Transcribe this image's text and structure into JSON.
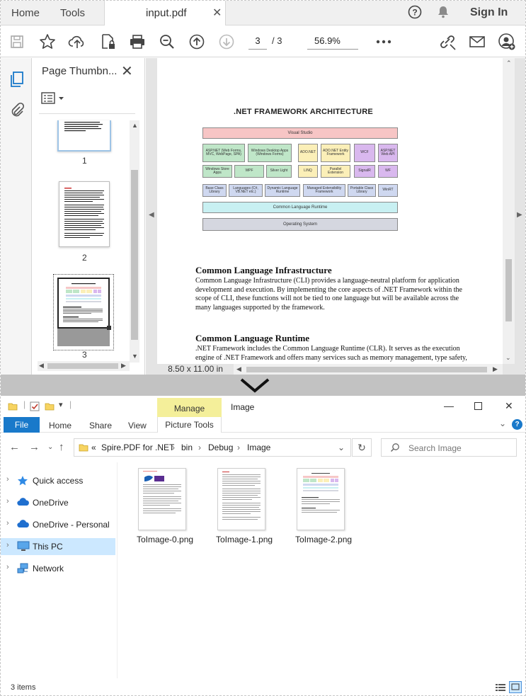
{
  "acrobat": {
    "tabs": {
      "home": "Home",
      "tools": "Tools",
      "document": "input.pdf"
    },
    "sign_in": "Sign In",
    "toolbar": {
      "current_page": "3",
      "total_pages": "/ 3",
      "zoom": "56.9%"
    },
    "thumbnails": {
      "title": "Page Thumbn...",
      "pages": [
        "1",
        "2",
        "3"
      ]
    },
    "page_size": "8.50 x 11.00 in",
    "document": {
      "diagram_title": ".NET FRAMEWORK ARCHITECTURE",
      "boxes": {
        "visual_studio": "Visual Studio",
        "aspnet": "ASP.NET (Web Forms, MVC, WebPage, SPA)",
        "windows_desktop": "Windows Desktop Apps (Windows Forms)",
        "adonet": "ADO.NET",
        "entity": "ADO.NET Entity Framework",
        "wcf": "WCF",
        "webapi": "ASP.NET Web API",
        "store_apps": "Windows Store Apps",
        "wpf": "WPF",
        "silverlight": "Silver Light",
        "linq": "LINQ",
        "parallel": "Parallel Extension",
        "signalr": "SignalR",
        "wf": "WF",
        "bcl": "Base Class Library",
        "languages": "Languages (C#, VB.NET etc.)",
        "dlr": "Dynamic Language Runtime",
        "mef": "Managed Extensibility Framework",
        "portable": "Portable Class Library",
        "winrt": "WinRT",
        "clr": "Common Language Runtime",
        "os": "Operating System"
      },
      "section1_heading": "Common Language Infrastructure",
      "section1_body": "Common Language Infrastructure (CLI) provides a language-neutral platform for application development and execution. By implementing the core aspects of .NET Framework within the scope of CLI, these functions will not be tied to one language but will be available across the many languages supported by the framework.",
      "section2_heading": "Common Language Runtime",
      "section2_body": ".NET Framework includes the Common Language Runtime (CLR). It serves as the execution engine of .NET Framework and offers many services such as memory management, type safety,"
    }
  },
  "explorer": {
    "manage_tab": "Manage",
    "window_title": "Image",
    "ribbon": {
      "file": "File",
      "home": "Home",
      "share": "Share",
      "view": "View",
      "picture_tools": "Picture Tools"
    },
    "breadcrumb": {
      "prefix": "«",
      "parts": [
        "Spire.PDF for .NET",
        "bin",
        "Debug",
        "Image"
      ]
    },
    "search_placeholder": "Search Image",
    "nav": [
      "Quick access",
      "OneDrive",
      "OneDrive - Personal",
      "This PC",
      "Network"
    ],
    "files": [
      "ToImage-0.png",
      "ToImage-1.png",
      "ToImage-2.png"
    ],
    "status": "3 items"
  },
  "colors": {
    "accent_blue": "#1979ca",
    "manage_yellow": "#f4ef9a",
    "selected_nav": "#cce8ff",
    "divider_gray": "#c2c2c2"
  },
  "icons": [
    "save-icon",
    "star-icon",
    "upload-cloud-icon",
    "lock-file-icon",
    "print-icon",
    "zoom-out-icon",
    "page-up-icon",
    "page-down-icon",
    "more-icon",
    "link-icon",
    "mail-icon",
    "account-icon",
    "help-icon",
    "bell-icon"
  ]
}
